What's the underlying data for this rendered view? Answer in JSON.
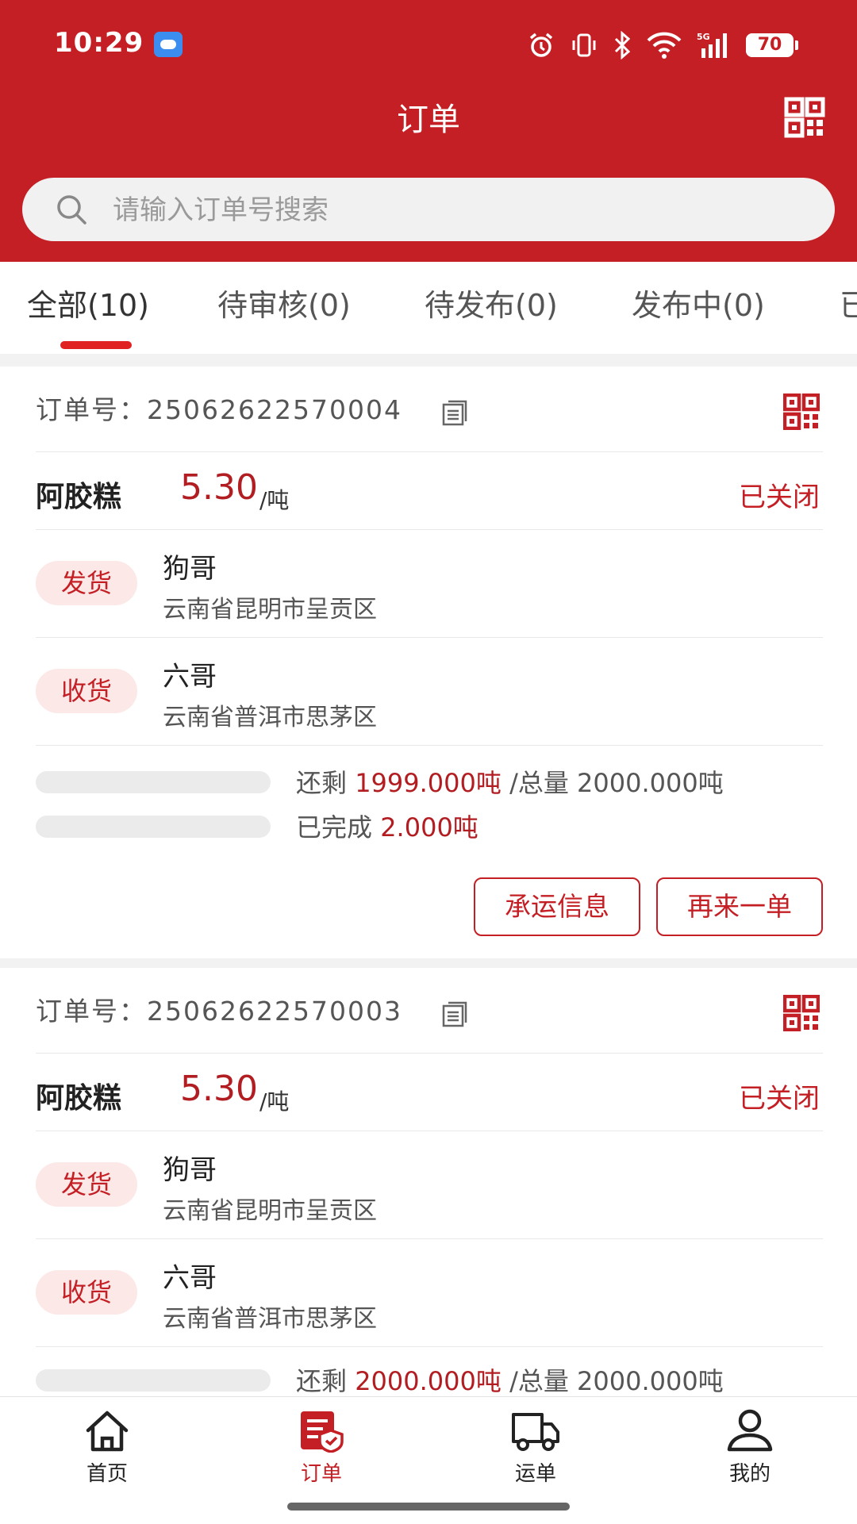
{
  "status_bar": {
    "time": "10:29",
    "battery": "70",
    "battery_pct": 70
  },
  "header": {
    "title": "订单"
  },
  "search": {
    "placeholder": "请输入订单号搜索"
  },
  "tabs": [
    {
      "label": "全部(10)",
      "active": true
    },
    {
      "label": "待审核(0)",
      "active": false
    },
    {
      "label": "待发布(0)",
      "active": false
    },
    {
      "label": "发布中(0)",
      "active": false
    },
    {
      "label": "已",
      "active": false
    }
  ],
  "colors": {
    "brand": "#c41f24",
    "accent_text": "#b21d22",
    "badge_bg": "#fde8e8"
  },
  "orders": [
    {
      "order_label": "订单号：",
      "order_no": "25062622570004",
      "product": "阿胶糕",
      "price": "5.30",
      "unit": "/吨",
      "status": "已关闭",
      "shipper": {
        "badge": "发货",
        "name": "狗哥",
        "address": "云南省昆明市呈贡区"
      },
      "receiver": {
        "badge": "收货",
        "name": "六哥",
        "address": "云南省普洱市思茅区"
      },
      "remaining_label": "还剩",
      "remaining": "1999.000吨",
      "total_label": "/总量",
      "total": "2000.000吨",
      "remaining_progress": 0,
      "completed_label": "已完成",
      "completed": "2.000吨",
      "completed_progress": 0,
      "buttons": [
        "承运信息",
        "再来一单"
      ]
    },
    {
      "order_label": "订单号：",
      "order_no": "25062622570003",
      "product": "阿胶糕",
      "price": "5.30",
      "unit": "/吨",
      "status": "已关闭",
      "shipper": {
        "badge": "发货",
        "name": "狗哥",
        "address": "云南省昆明市呈贡区"
      },
      "receiver": {
        "badge": "收货",
        "name": "六哥",
        "address": "云南省普洱市思茅区"
      },
      "remaining_label": "还剩",
      "remaining": "2000.000吨",
      "total_label": "/总量",
      "total": "2000.000吨",
      "remaining_progress": 0
    }
  ],
  "bottom_nav": [
    {
      "label": "首页",
      "icon": "home-icon",
      "active": false
    },
    {
      "label": "订单",
      "icon": "order-icon",
      "active": true
    },
    {
      "label": "运单",
      "icon": "truck-icon",
      "active": false
    },
    {
      "label": "我的",
      "icon": "user-icon",
      "active": false
    }
  ]
}
